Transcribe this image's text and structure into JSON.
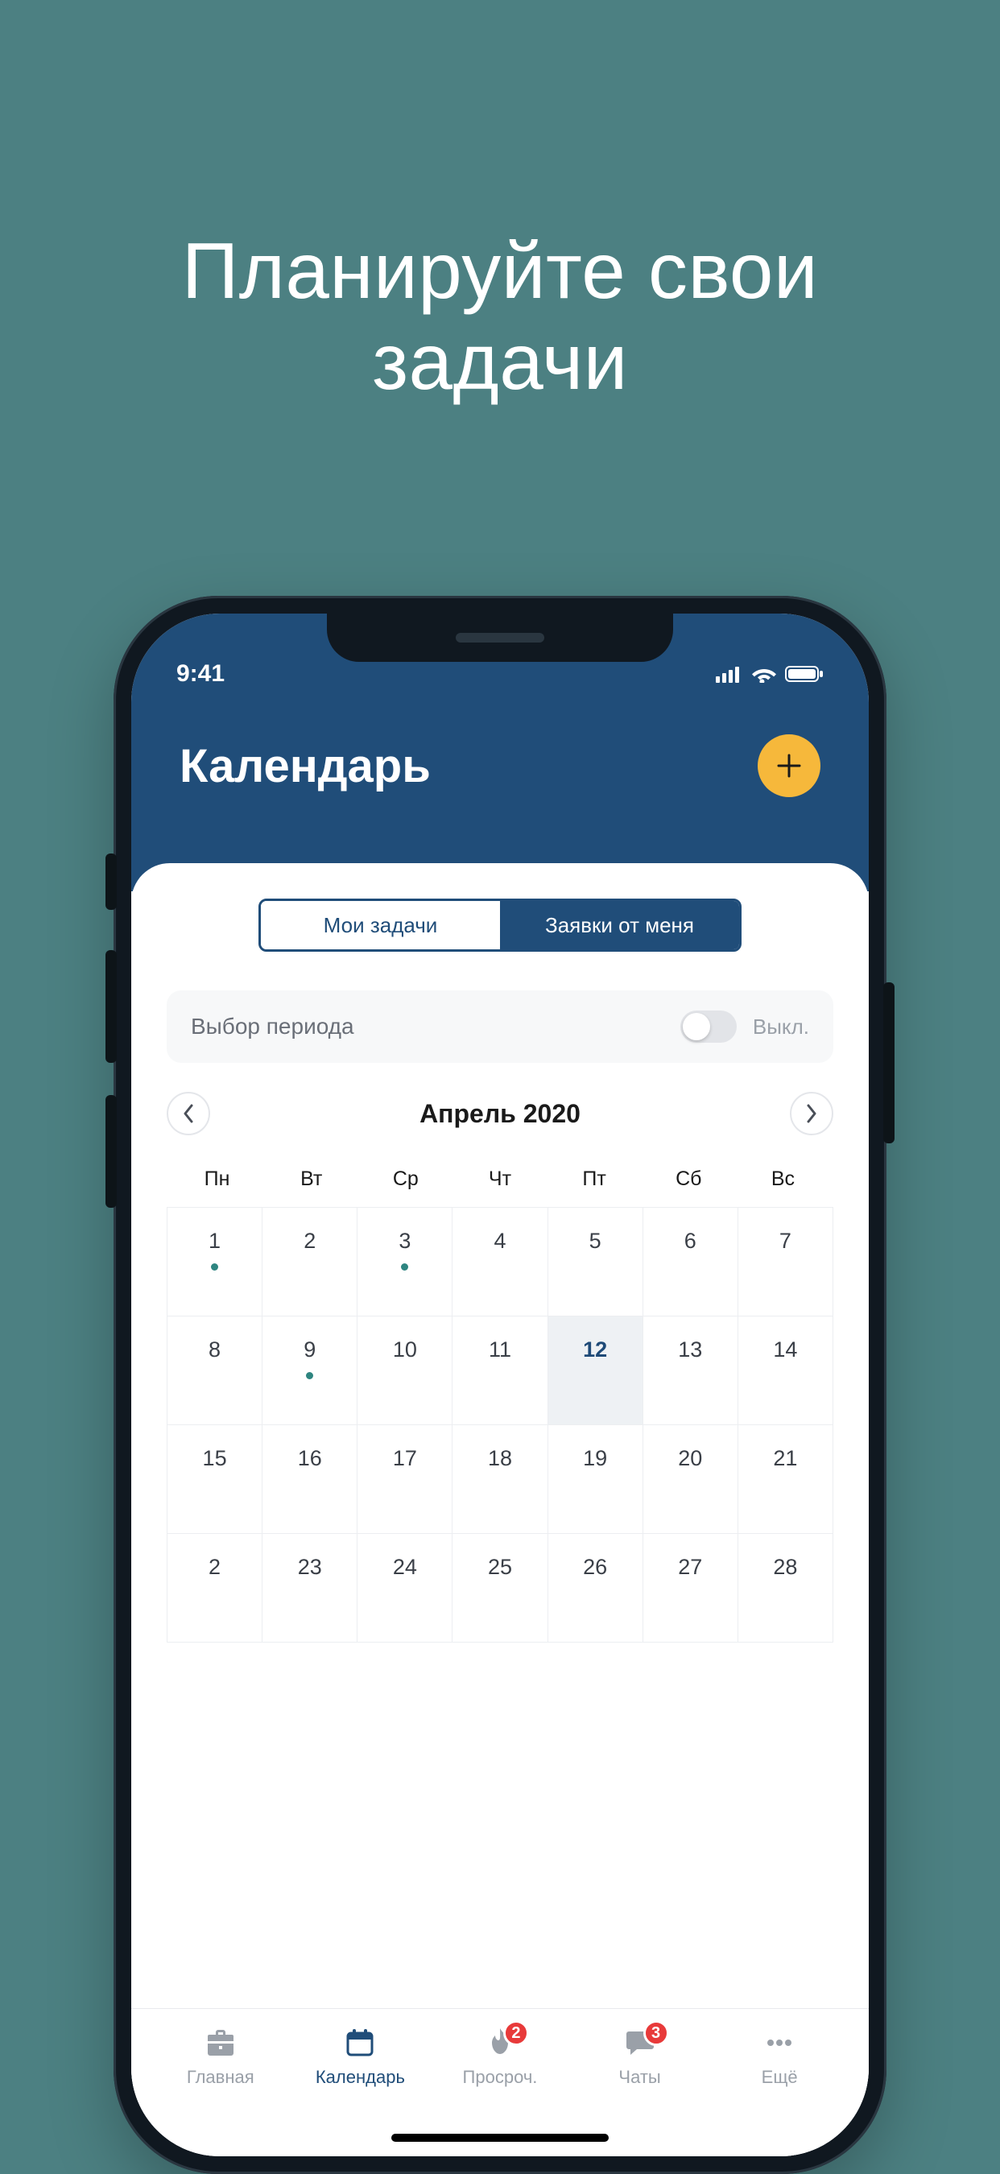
{
  "promo": {
    "line1": "Планируйте свои",
    "line2": "задачи"
  },
  "status": {
    "time": "9:41"
  },
  "header": {
    "title": "Календарь"
  },
  "segments": {
    "my_tasks": "Мои задачи",
    "requests": "Заявки от меня"
  },
  "period": {
    "label": "Выбор периода",
    "state_text": "Выкл."
  },
  "month": {
    "label": "Апрель 2020"
  },
  "weekdays": [
    "Пн",
    "Вт",
    "Ср",
    "Чт",
    "Пт",
    "Сб",
    "Вс"
  ],
  "calendar_rows": [
    [
      {
        "n": "1",
        "dot": true
      },
      {
        "n": "2"
      },
      {
        "n": "3",
        "dot": true
      },
      {
        "n": "4"
      },
      {
        "n": "5"
      },
      {
        "n": "6"
      },
      {
        "n": "7"
      }
    ],
    [
      {
        "n": "8"
      },
      {
        "n": "9",
        "dot": true
      },
      {
        "n": "10"
      },
      {
        "n": "11"
      },
      {
        "n": "12",
        "selected": true
      },
      {
        "n": "13"
      },
      {
        "n": "14"
      }
    ],
    [
      {
        "n": "15"
      },
      {
        "n": "16"
      },
      {
        "n": "17"
      },
      {
        "n": "18"
      },
      {
        "n": "19"
      },
      {
        "n": "20"
      },
      {
        "n": "21"
      }
    ],
    [
      {
        "n": "2"
      },
      {
        "n": "23"
      },
      {
        "n": "24"
      },
      {
        "n": "25"
      },
      {
        "n": "26"
      },
      {
        "n": "27"
      },
      {
        "n": "28"
      }
    ]
  ],
  "tabs": {
    "home": "Главная",
    "calendar": "Календарь",
    "overdue": "Просроч.",
    "chats": "Чаты",
    "more": "Ещё",
    "badge_overdue": "2",
    "badge_chats": "3"
  }
}
